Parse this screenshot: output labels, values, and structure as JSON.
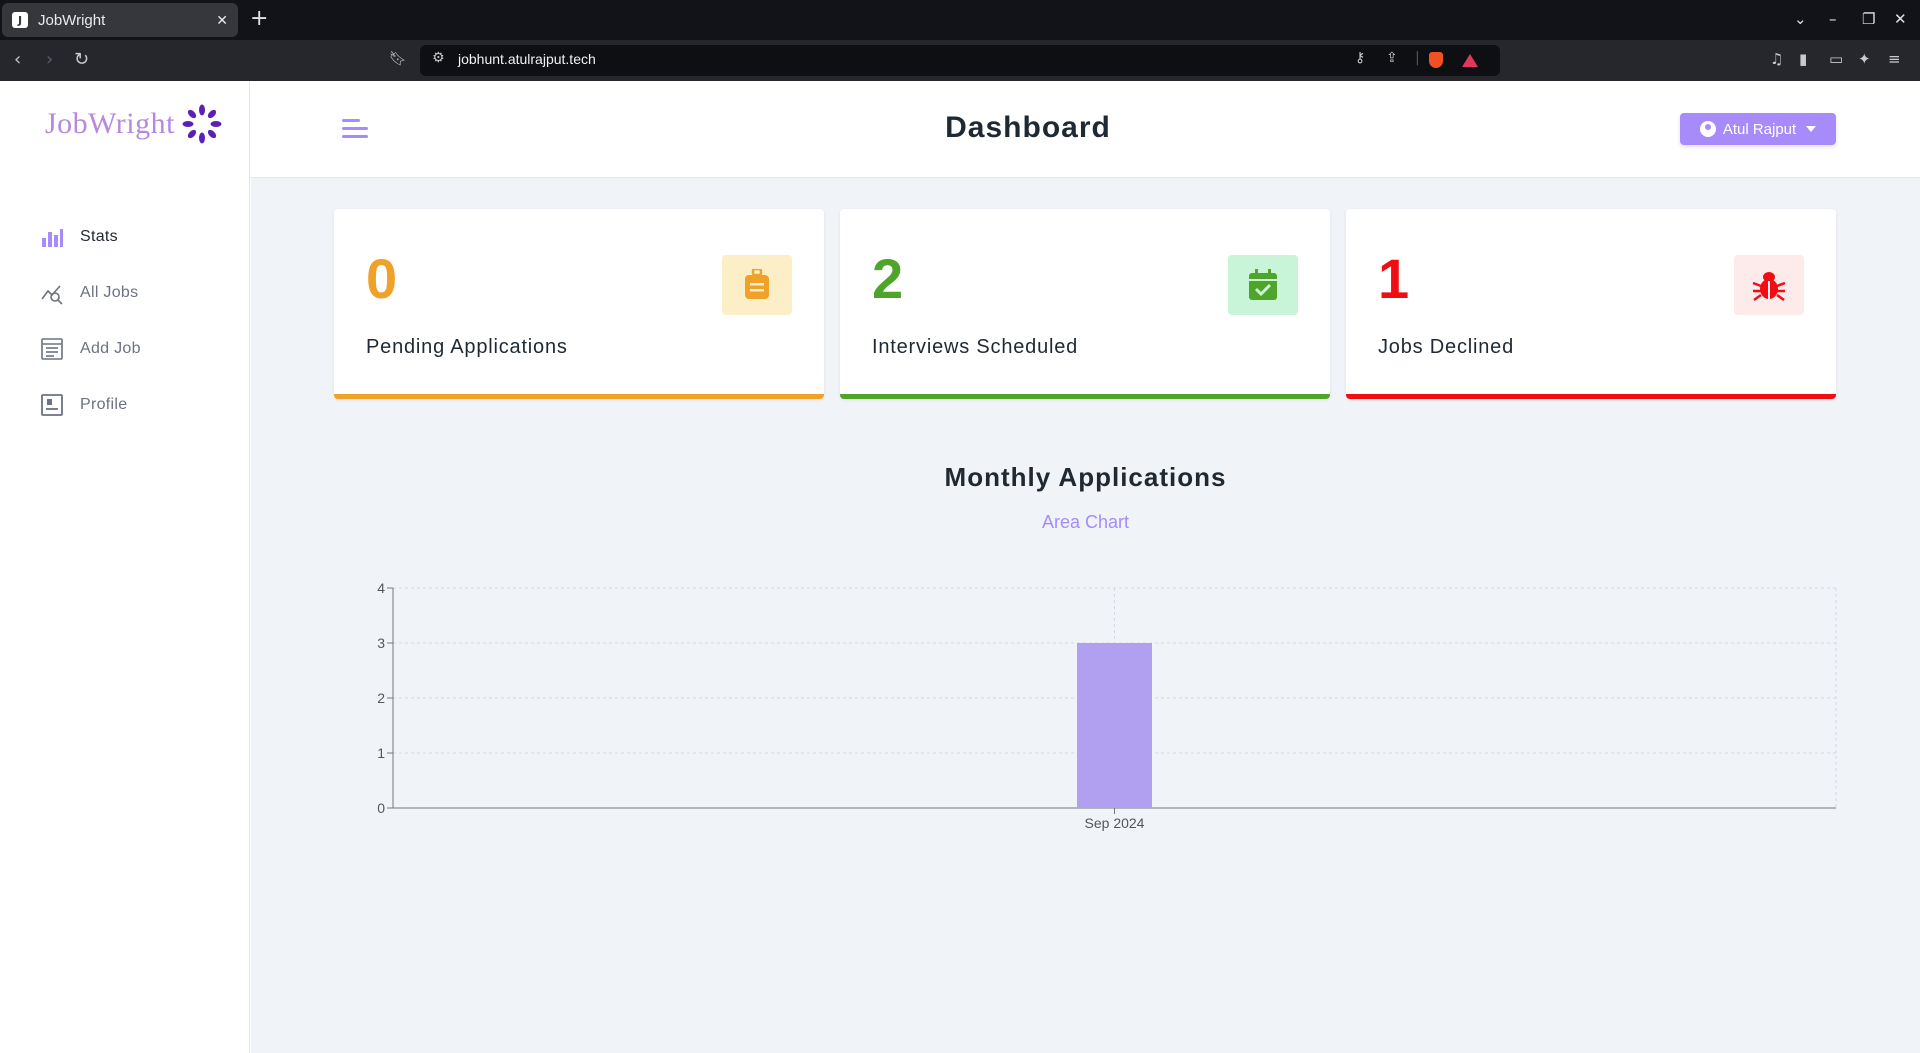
{
  "browser": {
    "tab_title": "JobWright",
    "tab_favicon": "J",
    "url": "jobhunt.atulrajput.tech"
  },
  "app": {
    "brand": "JobWright",
    "accent": "#a78bfa",
    "page_title": "Dashboard",
    "user_name": "Atul Rajput"
  },
  "sidebar": {
    "items": [
      {
        "label": "Stats",
        "icon": "bar-chart-icon",
        "active": true
      },
      {
        "label": "All Jobs",
        "icon": "line-chart-search-icon",
        "active": false
      },
      {
        "label": "Add Job",
        "icon": "form-icon",
        "active": false
      },
      {
        "label": "Profile",
        "icon": "id-card-icon",
        "active": false
      }
    ]
  },
  "stats": [
    {
      "count": "0",
      "label": "Pending Applications",
      "icon": "suitcase-icon",
      "color": "#f0a12a",
      "bg": "#fcefc7"
    },
    {
      "count": "2",
      "label": "Interviews Scheduled",
      "icon": "calendar-check-icon",
      "color": "#4fa52a",
      "bg": "#c8f5d8"
    },
    {
      "count": "1",
      "label": "Jobs Declined",
      "icon": "bug-icon",
      "color": "#ee0e13",
      "bg": "#fdeaea"
    }
  ],
  "chart": {
    "title": "Monthly Applications",
    "toggle_label": "Area Chart"
  },
  "chart_data": {
    "type": "bar",
    "categories": [
      "Sep 2024"
    ],
    "values": [
      3
    ],
    "title": "Monthly Applications",
    "xlabel": "",
    "ylabel": "",
    "ylim": [
      0,
      4
    ],
    "yticks": [
      0,
      1,
      2,
      3,
      4
    ],
    "grid": true,
    "bar_color": "#b19ff0"
  }
}
